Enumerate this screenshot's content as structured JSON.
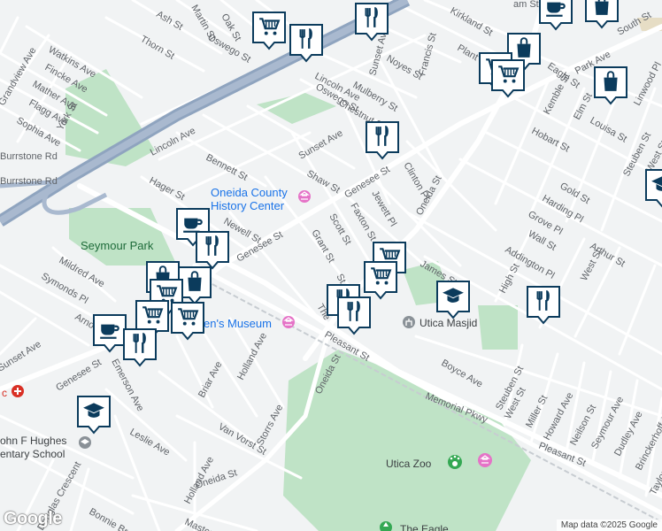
{
  "map": {
    "attribution": "Map data ©2025 Google",
    "logo": "Google",
    "colors": {
      "background": "#f1f3f4",
      "park": "#bfe3c6",
      "highway": "#8fa4bf",
      "road": "#ffffff",
      "pin": "#0b3b5c"
    },
    "pois": {
      "history_center_line1": "Oneida County",
      "history_center_line2": "History Center",
      "museum": "en's Museum",
      "masjid": "Utica Masjid",
      "zoo": "Utica Zoo",
      "eagle": "The Eagle",
      "seymour_park": "Seymour Park",
      "school_line1": "ohn F Hughes",
      "school_line2": "entary School",
      "hospital_fragment": "c"
    },
    "streets": {
      "ash": "Ash St",
      "martin": "Martin St",
      "oak": "Oak St",
      "oswego_top": "Oswego St",
      "thorn": "Thorn St",
      "watkins": "Watkins Ave",
      "fincke": "Fincke Ave",
      "mather": "Mather Ave",
      "grandview": "Grandview Ave",
      "flagg": "Flagg Ave",
      "york": "York St",
      "sophia": "Sophia Ave",
      "burrstone1": "Burrstone Rd",
      "burrstone2": "Burrstone Rd",
      "lincoln_w": "Lincoln Ave",
      "bennett": "Bennett St",
      "hager": "Hager St",
      "newell": "Newell St",
      "genesee_w": "Genesee St",
      "sunset_top": "Sunset Ave",
      "lincoln_e": "Lincoln Ave",
      "mulberry": "Mulberry St",
      "noyes": "Noyes St",
      "francis": "Francis St",
      "kirkland": "Kirkland St",
      "plant": "Plant St",
      "oswego_mid": "Oswego St",
      "chestnut": "Chestnut St",
      "sunset_mid": "Sunset Ave",
      "shaw": "Shaw St",
      "genesee_mid": "Genesee St",
      "clinton": "Clinton Pl",
      "jewett": "Jewett Pl",
      "faxton": "Faxton St",
      "scott": "Scott St",
      "grant": "Grant St",
      "the": "The",
      "st_frag": "St",
      "oneida_n": "Oneida St",
      "james": "James St",
      "eagle": "Eagle St",
      "park": "Park Ave",
      "hobart": "Hobart St",
      "kemble": "Kemble St",
      "elm": "Elm St",
      "louisa": "Louisa St",
      "linwood": "Linwood Pl",
      "south": "South St",
      "steuben_ne": "Steuben St",
      "west_ne": "West St",
      "gold": "Gold St",
      "harding": "Harding Pl",
      "grove": "Grove Pl",
      "wall": "Wall St",
      "arthur": "Arthur St",
      "addington": "Addington Pl",
      "high": "High St",
      "west_mid": "West St",
      "mildred": "Mildred Ave",
      "symonds": "Symonds Pl",
      "arno": "Arno",
      "sunset_sw": "Sunset Ave",
      "genesee_sw": "Genesee St",
      "emerson": "Emerson Ave",
      "briar": "Briar Ave",
      "holland_n": "Holland Ave",
      "oneida_s": "Oneida St",
      "pleasant": "Pleasant St",
      "boyce": "Boyce Ave",
      "steuben_s": "Steuben St",
      "west_s": "West St",
      "miller": "Miller St",
      "howard": "Howard Ave",
      "neilson": "Neilson St",
      "seymour": "Seymour Ave",
      "dudley": "Dudley Ave",
      "brinckerhoff": "Brinckerhoff Ave",
      "taylor": "Taylor Ave",
      "memorial": "Memorial Pkwy",
      "pleasant_se": "Pleasant St",
      "van_vorst": "Van Vorst St",
      "storrs": "Storrs Ave",
      "leslie": "Leslie Ave",
      "holland_s": "Holland Ave",
      "oneida_sw": "Oneida St",
      "bonnie": "Bonnie Bra",
      "master": "Master",
      "douglas": "Douglas Crescent",
      "ams": "am St"
    },
    "markers": [
      {
        "type": "shopping-cart"
      },
      {
        "type": "restaurant"
      },
      {
        "type": "restaurant"
      },
      {
        "type": "cafe"
      },
      {
        "type": "shopping-bag"
      },
      {
        "type": "shopping-bag"
      },
      {
        "type": "shopping-cart"
      },
      {
        "type": "shopping-cart"
      },
      {
        "type": "shopping-bag"
      },
      {
        "type": "restaurant"
      },
      {
        "type": "cafe"
      },
      {
        "type": "restaurant"
      },
      {
        "type": "shopping-bag"
      },
      {
        "type": "shopping-bag"
      },
      {
        "type": "shopping-cart"
      },
      {
        "type": "shopping-cart"
      },
      {
        "type": "shopping-cart"
      },
      {
        "type": "cafe"
      },
      {
        "type": "restaurant"
      },
      {
        "type": "shopping-cart"
      },
      {
        "type": "shopping-cart"
      },
      {
        "type": "restaurant"
      },
      {
        "type": "restaurant"
      },
      {
        "type": "school"
      },
      {
        "type": "restaurant"
      },
      {
        "type": "school"
      },
      {
        "type": "school"
      }
    ]
  }
}
